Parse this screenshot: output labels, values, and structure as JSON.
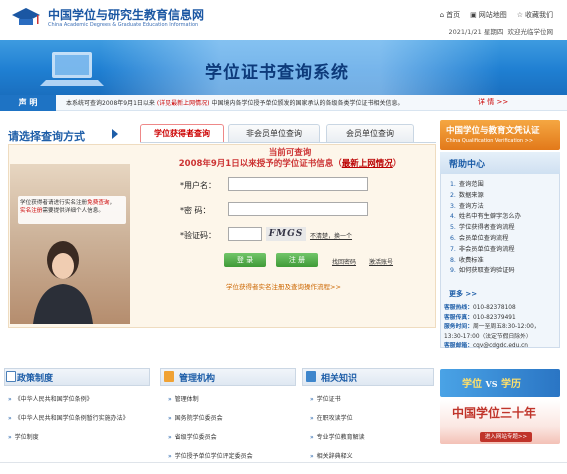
{
  "header": {
    "site_name_cn": "中国学位与研究生教育信息网",
    "site_name_en": "China Academic Degrees & Graduate Education Information",
    "links": [
      {
        "icon": "home-icon",
        "label": "首页"
      },
      {
        "icon": "sitemap-icon",
        "label": "网站地图"
      },
      {
        "icon": "star-icon",
        "label": "收藏我们"
      }
    ],
    "date": "2021/1/21 星期四",
    "welcome": "欢迎光临学位网"
  },
  "banner": {
    "title": "学位证书查询系统"
  },
  "notice": {
    "label": "声  明",
    "text_before": "本系统可查询2008年9月1日以来",
    "link": "(详见最新上网情况)",
    "text_after": "中国境内各学位授予单位颁发的国家承认的各级各类学位证书相关信息。",
    "detail": "详 情 >>"
  },
  "query": {
    "title": "请选择查询方式",
    "tabs": [
      "学位获得者查询",
      "非会员单位查询",
      "会员单位查询"
    ],
    "hint_text": "学位获得者请进行实名注册",
    "hint_link1": "免费查询",
    "hint_link2": "实名注册",
    "hint_text2": "需要提供详细个人信息。",
    "center_line1": "当前可查询",
    "center_line2_a": "2008年9月1日以来授予的学位证书信息（",
    "center_line2_link": "最新上网情况",
    "center_line2_b": "）",
    "label_user": "*用户名：",
    "label_pwd": "*密    码：",
    "label_code": "*验证码：",
    "captcha": "FMGS",
    "captcha_refresh": "不清楚，换一个",
    "btn_login": "登  录",
    "btn_register": "注  册",
    "find_pwd": "找回密码",
    "activate": "激活账号",
    "flow_link": "学位获得者实名注册及查询操作流程>>"
  },
  "aside": {
    "auth_cn": "中国学位与教育文凭认证",
    "auth_en": "China Qualification Verification >>",
    "help_title": "帮助中心",
    "help_items": [
      "查询范围",
      "数据来源",
      "查询方法",
      "姓名中有生僻字怎么办",
      "学位获得者查询流程",
      "会员单位查询流程",
      "非会员单位查询流程",
      "收费标准",
      "如何获取查询验证码"
    ],
    "more": "更多 >>",
    "contact": [
      {
        "label": "客服热线：",
        "value": "010-82378108"
      },
      {
        "label": "客服传真：",
        "value": "010-82379491"
      },
      {
        "label": "服务时间：",
        "value": "周一至周五8:30-12:00，"
      },
      {
        "label": "",
        "value": "13:30-17:00（法定节假日除外）"
      },
      {
        "label": "客服邮箱：",
        "value": "cqv@cdgdc.edu.cn"
      }
    ]
  },
  "sections": [
    {
      "title": "政策制度",
      "items": [
        "《中华人民共和国学位条例》",
        "《中华人民共和国学位条例暂行实施办法》",
        "学位制度"
      ]
    },
    {
      "title": "管理机构",
      "items": [
        "管理体制",
        "国务院学位委员会",
        "省级学位委员会",
        "学位授予单位学位评定委员会"
      ]
    },
    {
      "title": "相关知识",
      "items": [
        "学位证书",
        "在职攻读学位",
        "专业学位教育解读",
        "相关辞典释义"
      ]
    }
  ],
  "promos": {
    "vs_left": "学位",
    "vs_mid": "VS",
    "vs_right": "学历",
    "anniv_title": "中国学位三十年",
    "anniv_btn": "进入网站专题>>"
  },
  "colors": {
    "brand_blue": "#1e5ea8",
    "accent_red": "#c00000",
    "orange": "#e2791a",
    "green": "#3f9a37"
  }
}
